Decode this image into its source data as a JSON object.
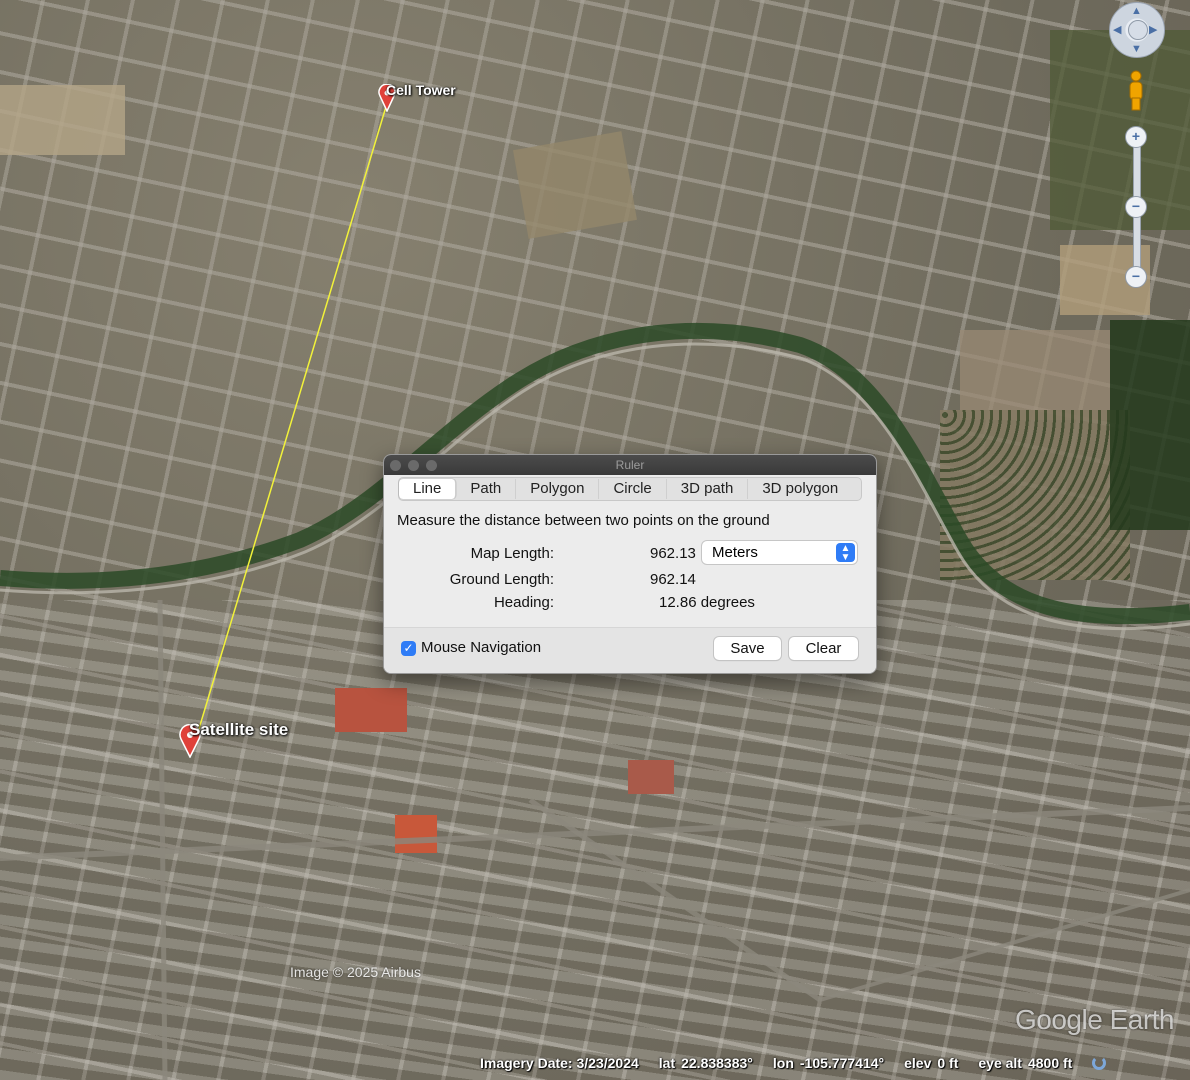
{
  "map": {
    "watermark": "Image © 2025 Airbus",
    "brand": "Google Earth",
    "placemarks": [
      {
        "label": "Cell Tower"
      },
      {
        "label": "Satellite site"
      }
    ],
    "measure_line_color": "#f2f23a",
    "pin_color": "#e0413a"
  },
  "status_bar": {
    "imagery_date": "Imagery Date: 3/23/2024",
    "lat_label": "lat",
    "lat_value": "22.838383°",
    "lon_label": "lon",
    "lon_value": "-105.777414°",
    "elev_label": "elev",
    "elev_value": "0 ft",
    "eye_alt_label": "eye alt",
    "eye_alt_value": "4800 ft"
  },
  "nav_controls": {
    "icons": [
      "look-joystick-icon",
      "street-view-pegman-icon",
      "zoom-in-icon",
      "zoom-out-icon"
    ]
  },
  "ruler": {
    "title": "Ruler",
    "tabs": [
      "Line",
      "Path",
      "Polygon",
      "Circle",
      "3D path",
      "3D polygon"
    ],
    "active_tab": "Line",
    "description": "Measure the distance between two points on the ground",
    "map_length_label": "Map Length:",
    "map_length_value": "962.13",
    "unit": "Meters",
    "ground_length_label": "Ground Length:",
    "ground_length_value": "962.14",
    "heading_label": "Heading:",
    "heading_value": "12.86 degrees",
    "mouse_navigation_label": "Mouse Navigation",
    "mouse_navigation_checked": true,
    "save_label": "Save",
    "clear_label": "Clear",
    "accent": "#2f7cf6"
  }
}
